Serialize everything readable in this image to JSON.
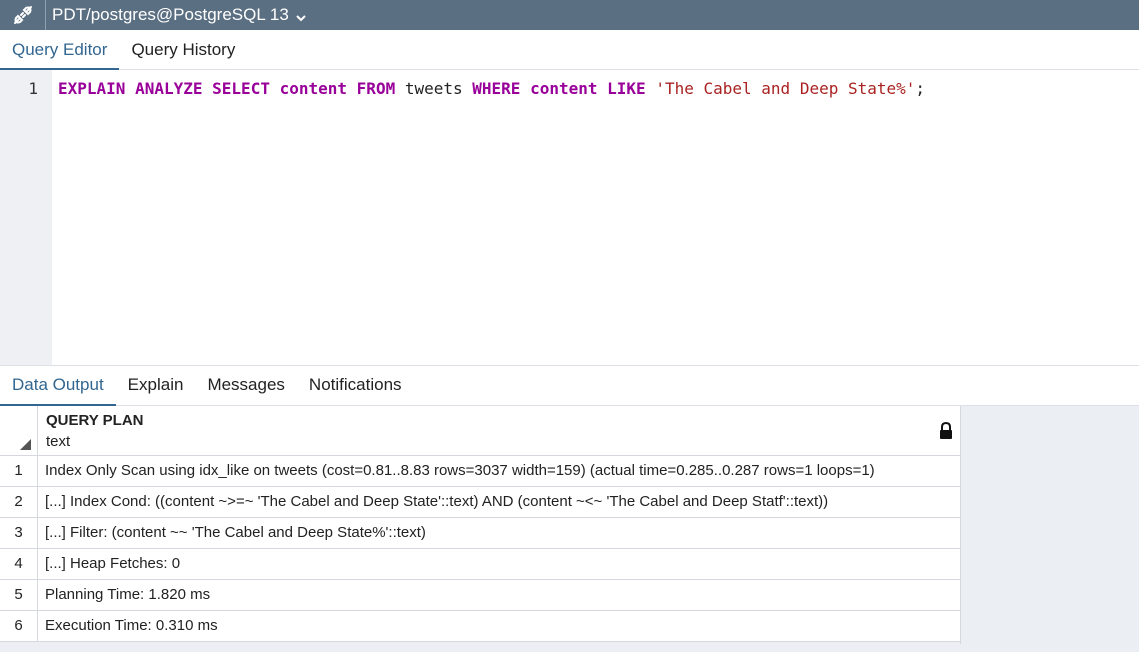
{
  "connection": {
    "title": "PDT/postgres@PostgreSQL 13",
    "icon": "connection-plug-icon",
    "caret_icon": "chevron-down-icon"
  },
  "editor_tabs": [
    {
      "label": "Query Editor",
      "active": true
    },
    {
      "label": "Query History",
      "active": false
    }
  ],
  "editor": {
    "line_number": "1",
    "tokens": [
      {
        "text": "EXPLAIN",
        "type": "kw"
      },
      {
        "text": " ",
        "type": "plain"
      },
      {
        "text": "ANALYZE",
        "type": "kw"
      },
      {
        "text": " ",
        "type": "plain"
      },
      {
        "text": "SELECT",
        "type": "kw"
      },
      {
        "text": " ",
        "type": "plain"
      },
      {
        "text": "content",
        "type": "kw"
      },
      {
        "text": " ",
        "type": "plain"
      },
      {
        "text": "FROM",
        "type": "kw"
      },
      {
        "text": " tweets ",
        "type": "plain"
      },
      {
        "text": "WHERE",
        "type": "kw"
      },
      {
        "text": " ",
        "type": "plain"
      },
      {
        "text": "content",
        "type": "kw"
      },
      {
        "text": " ",
        "type": "plain"
      },
      {
        "text": "LIKE",
        "type": "kw"
      },
      {
        "text": " ",
        "type": "plain"
      },
      {
        "text": "'The Cabel and Deep State%'",
        "type": "str"
      },
      {
        "text": ";",
        "type": "plain"
      }
    ]
  },
  "output_tabs": [
    {
      "label": "Data Output",
      "active": true
    },
    {
      "label": "Explain",
      "active": false
    },
    {
      "label": "Messages",
      "active": false
    },
    {
      "label": "Notifications",
      "active": false
    }
  ],
  "grid": {
    "column": {
      "name": "QUERY PLAN",
      "type": "text",
      "lock_icon": "lock-icon"
    },
    "rows": [
      {
        "num": "1",
        "value": "Index Only Scan using idx_like on tweets  (cost=0.81..8.83 rows=3037 width=159) (actual time=0.285..0.287 rows=1 loops=1)"
      },
      {
        "num": "2",
        "value": "[...] Index Cond: ((content ~>=~ 'The Cabel and Deep State'::text) AND (content ~<~ 'The Cabel and Deep Statf'::text))"
      },
      {
        "num": "3",
        "value": "[...] Filter: (content ~~ 'The Cabel and Deep State%'::text)"
      },
      {
        "num": "4",
        "value": "[...] Heap Fetches: 0"
      },
      {
        "num": "5",
        "value": "Planning Time: 1.820 ms"
      },
      {
        "num": "6",
        "value": "Execution Time: 0.310 ms"
      }
    ]
  },
  "colors": {
    "connection_bar": "#5b6f82",
    "active_tab": "#326690",
    "keyword": "#990099",
    "string": "#aa2222"
  }
}
